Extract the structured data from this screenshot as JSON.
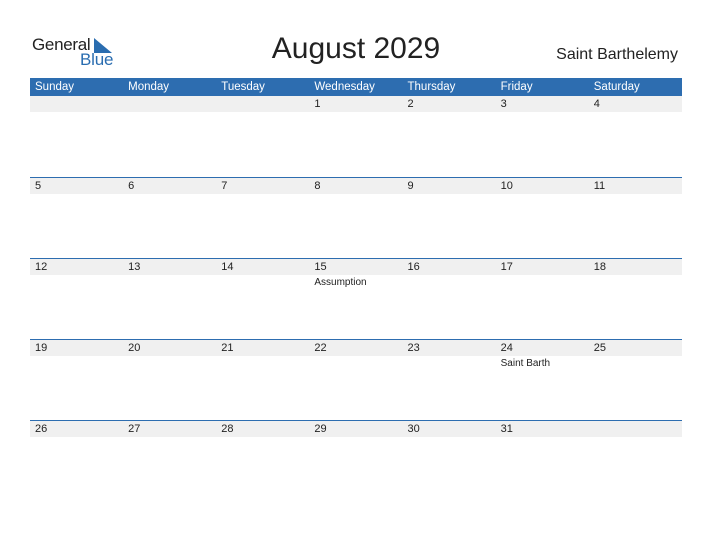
{
  "logo": {
    "line1": "General",
    "line2": "Blue"
  },
  "title": "August 2029",
  "region": "Saint Barthelemy",
  "colors": {
    "header_bg": "#2d6db0",
    "day_bg": "#f0f0f0",
    "accent": "#2a6db0"
  },
  "weekdays": [
    "Sunday",
    "Monday",
    "Tuesday",
    "Wednesday",
    "Thursday",
    "Friday",
    "Saturday"
  ],
  "weeks": [
    [
      {
        "d": ""
      },
      {
        "d": ""
      },
      {
        "d": ""
      },
      {
        "d": "1"
      },
      {
        "d": "2"
      },
      {
        "d": "3"
      },
      {
        "d": "4"
      }
    ],
    [
      {
        "d": "5"
      },
      {
        "d": "6"
      },
      {
        "d": "7"
      },
      {
        "d": "8"
      },
      {
        "d": "9"
      },
      {
        "d": "10"
      },
      {
        "d": "11"
      }
    ],
    [
      {
        "d": "12"
      },
      {
        "d": "13"
      },
      {
        "d": "14"
      },
      {
        "d": "15",
        "e": "Assumption"
      },
      {
        "d": "16"
      },
      {
        "d": "17"
      },
      {
        "d": "18"
      }
    ],
    [
      {
        "d": "19"
      },
      {
        "d": "20"
      },
      {
        "d": "21"
      },
      {
        "d": "22"
      },
      {
        "d": "23"
      },
      {
        "d": "24",
        "e": "Saint Barth"
      },
      {
        "d": "25"
      }
    ],
    [
      {
        "d": "26"
      },
      {
        "d": "27"
      },
      {
        "d": "28"
      },
      {
        "d": "29"
      },
      {
        "d": "30"
      },
      {
        "d": "31"
      },
      {
        "d": ""
      }
    ]
  ]
}
